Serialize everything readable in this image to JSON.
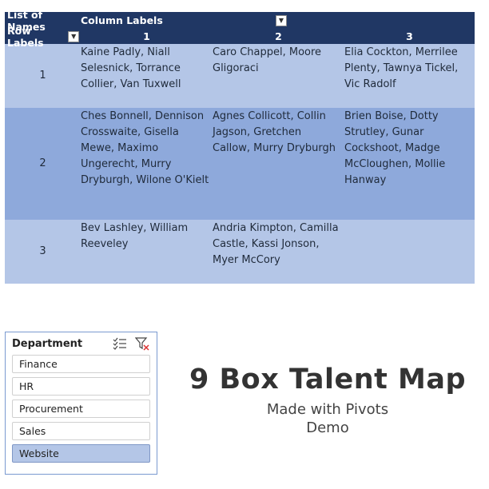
{
  "pivot": {
    "header": {
      "data_label": "List of Names",
      "column_labels": "Column Labels",
      "row_labels": "Row Labels",
      "columns": [
        "1",
        "2",
        "3"
      ]
    },
    "rows": [
      {
        "label": "1",
        "cells": [
          "Kaine Padly, Niall Selesnick, Torrance Collier, Van Tuxwell",
          "Caro Chappel, Moore Gligoraci",
          "Elia Cockton, Merrilee Plenty, Tawnya Tickel, Vic Radolf"
        ]
      },
      {
        "label": "2",
        "cells": [
          "Ches Bonnell, Dennison Crosswaite, Gisella Mewe, Maximo Ungerecht, Murry Dryburgh, Wilone O'Kielt",
          "Agnes Collicott, Collin Jagson, Gretchen Callow, Murry Dryburgh",
          "Brien Boise, Dotty Strutley, Gunar Cockshoot, Madge McCloughen, Mollie Hanway"
        ]
      },
      {
        "label": "3",
        "cells": [
          "Bev Lashley, William Reeveley",
          "Andria Kimpton, Camilla Castle, Kassi Jonson, Myer McCory",
          ""
        ]
      }
    ],
    "colors": {
      "header": "#203764",
      "band_light": "#b4c6e7",
      "band_dark": "#8ea9db"
    }
  },
  "slicer": {
    "title": "Department",
    "icons": [
      "multi-select-icon",
      "clear-filter-icon"
    ],
    "items": [
      {
        "label": "Finance",
        "selected": false
      },
      {
        "label": "HR",
        "selected": false
      },
      {
        "label": "Procurement",
        "selected": false
      },
      {
        "label": "Sales",
        "selected": false
      },
      {
        "label": "Website",
        "selected": true
      }
    ]
  },
  "title_block": {
    "title": "9 Box Talent Map",
    "line1": "Made with Pivots",
    "line2": "Demo"
  }
}
